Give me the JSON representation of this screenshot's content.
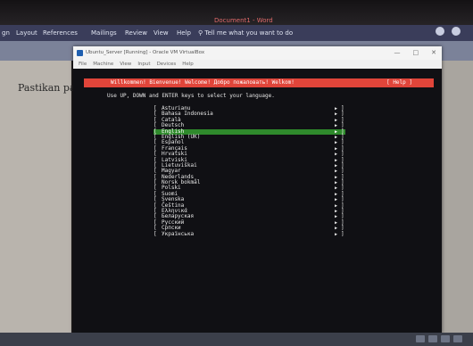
{
  "word": {
    "tabs": [
      "gn",
      "Layout",
      "References",
      "Mailings",
      "Review",
      "View",
      "Help"
    ],
    "tell_me": "Tell me what you want to do",
    "doc_title": "Document1 - Word",
    "doc_text": "Pastikan pada"
  },
  "vbox": {
    "title": "Ubuntu_Server [Running] - Oracle VM VirtualBox",
    "menu": [
      "File",
      "Machine",
      "View",
      "Input",
      "Devices",
      "Help"
    ],
    "win_buttons": [
      "—",
      "□",
      "✕"
    ]
  },
  "installer": {
    "welcome": "Willkommen! Bienvenue! Welcome! Добро пожаловать! Welkom!",
    "help": "[ Help ]",
    "instruction": "Use UP, DOWN and ENTER keys to select your language.",
    "selected_index": 4,
    "arrow_glyph": "▶",
    "languages": [
      "Asturianu",
      "Bahasa Indonesia",
      "Català",
      "Deutsch",
      "English",
      "English (UK)",
      "Español",
      "Français",
      "Hrvatski",
      "Latviski",
      "Lietuviškai",
      "Magyar",
      "Nederlands",
      "Norsk bokmål",
      "Polski",
      "Suomi",
      "Svenska",
      "Čeština",
      "Ελληνικά",
      "Беларуская",
      "Русский",
      "Српски",
      "Українська"
    ]
  }
}
